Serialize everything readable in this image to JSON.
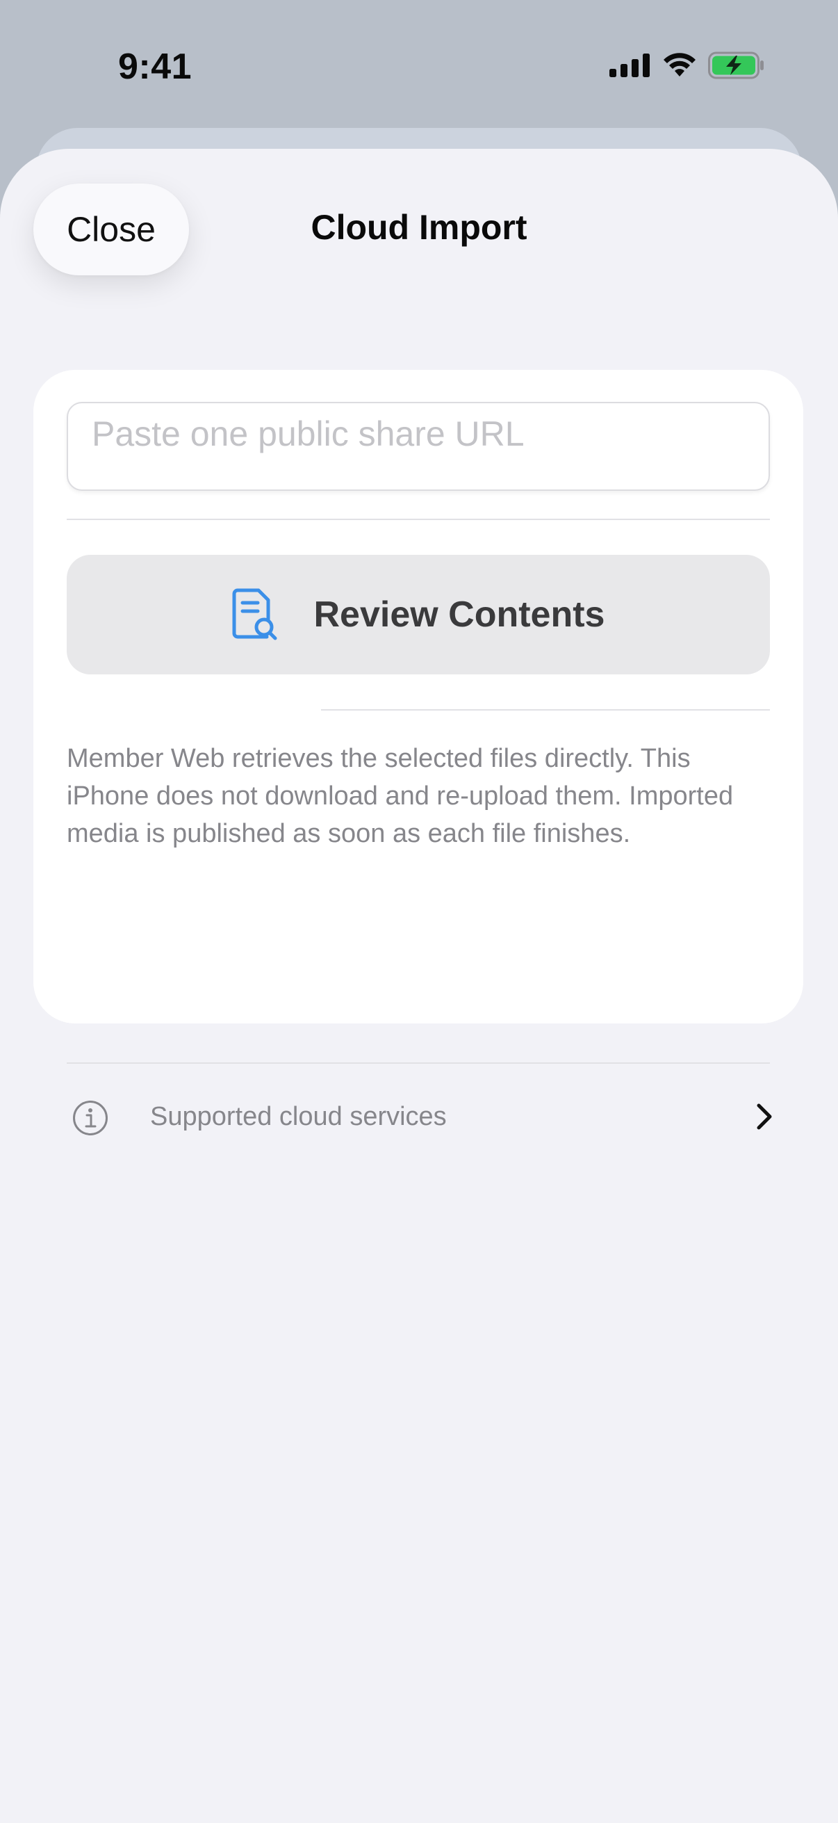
{
  "status_bar": {
    "time": "9:41",
    "icons": [
      "signal-icon",
      "wifi-icon",
      "battery-charging-icon"
    ],
    "battery_color": "#34c759"
  },
  "header": {
    "close_label": "Close",
    "title": "Cloud Import"
  },
  "form": {
    "url_placeholder": "Paste one public share URL",
    "url_value": "",
    "review_button_label": "Review Contents",
    "review_icon": "document-search-icon",
    "accent_color": "#3b8fe8"
  },
  "info": {
    "text": "Member Web retrieves the selected files directly. This iPhone does not download and re-upload them. Imported media is published as soon as each file finishes."
  },
  "services_row": {
    "icon": "info-circle-icon",
    "label": "Supported cloud services",
    "chevron": "chevron-right-icon"
  }
}
